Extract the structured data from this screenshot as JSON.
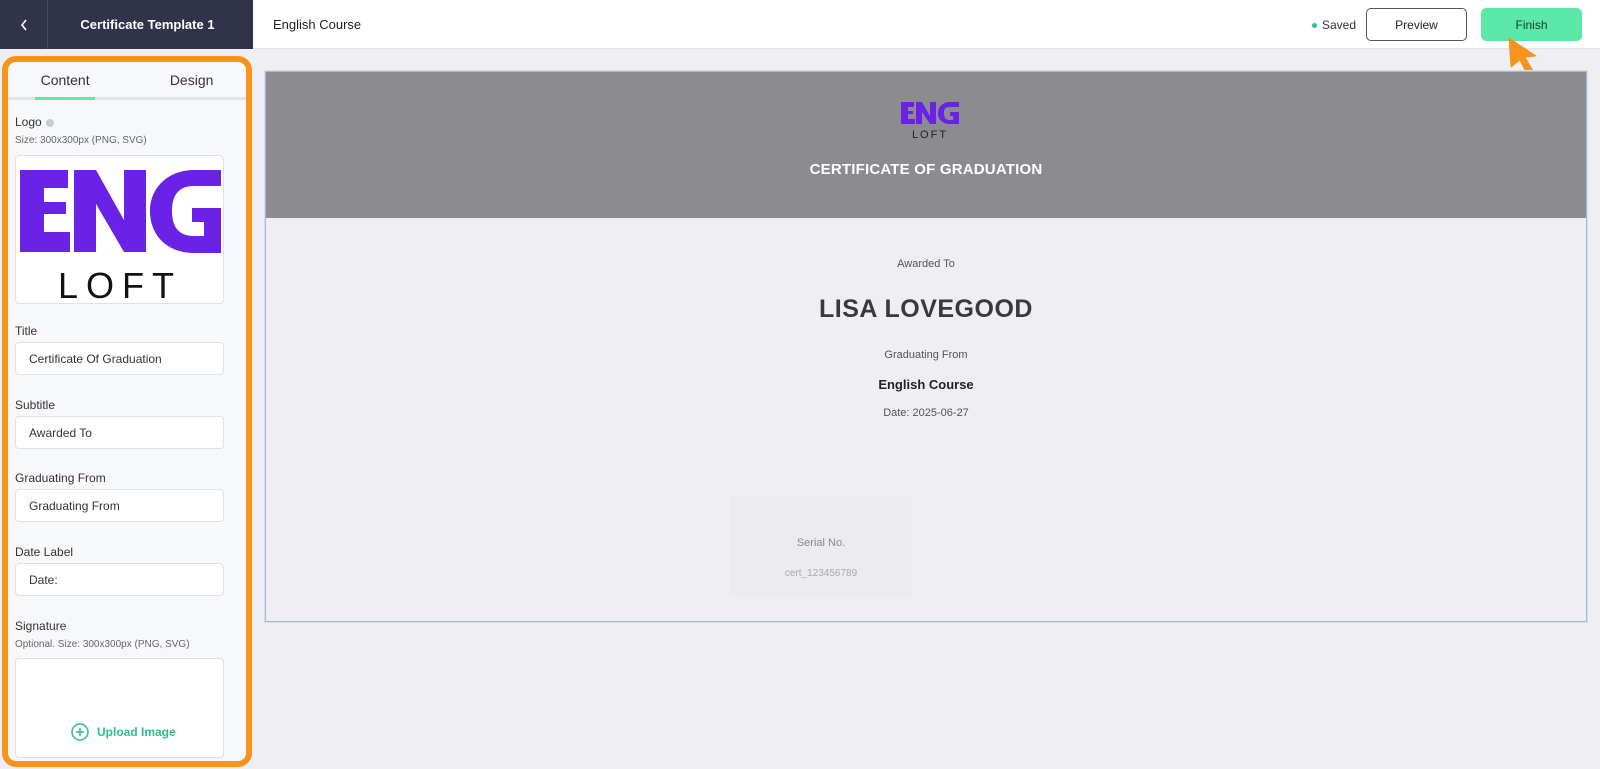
{
  "header": {
    "template_name": "Certificate Template 1",
    "course_name": "English Course",
    "status": "Saved",
    "preview_label": "Preview",
    "finish_label": "Finish"
  },
  "panel": {
    "tabs": [
      "Content",
      "Design"
    ],
    "active_tab": "Content",
    "logo": {
      "label": "Logo",
      "hint": "Size: 300x300px (PNG, SVG)",
      "logo_text_top": "ENG",
      "logo_text_bottom": "LOFT"
    },
    "title": {
      "label": "Title",
      "value": "Certificate Of Graduation"
    },
    "subtitle": {
      "label": "Subtitle",
      "value": "Awarded To"
    },
    "graduating_from": {
      "label": "Graduating From",
      "value": "Graduating From"
    },
    "date_label": {
      "label": "Date Label",
      "value": "Date:"
    },
    "signature": {
      "label": "Signature",
      "hint": "Optional. Size: 300x300px (PNG, SVG)",
      "upload_label": "Upload Image"
    }
  },
  "certificate": {
    "title": "CERTIFICATE OF GRADUATION",
    "subtitle": "Awarded To",
    "recipient": "LISA LOVEGOOD",
    "graduating_from_label": "Graduating From",
    "course": "English Course",
    "date": "Date: 2025-06-27",
    "serial_label": "Serial No.",
    "serial_value": "cert_123456789"
  },
  "colors": {
    "accent": "#5ce8a8",
    "sidebar_dark": "#30334a",
    "logo_purple": "#6a22e6",
    "highlight": "#f7941d",
    "cert_header": "#8c8c90"
  }
}
